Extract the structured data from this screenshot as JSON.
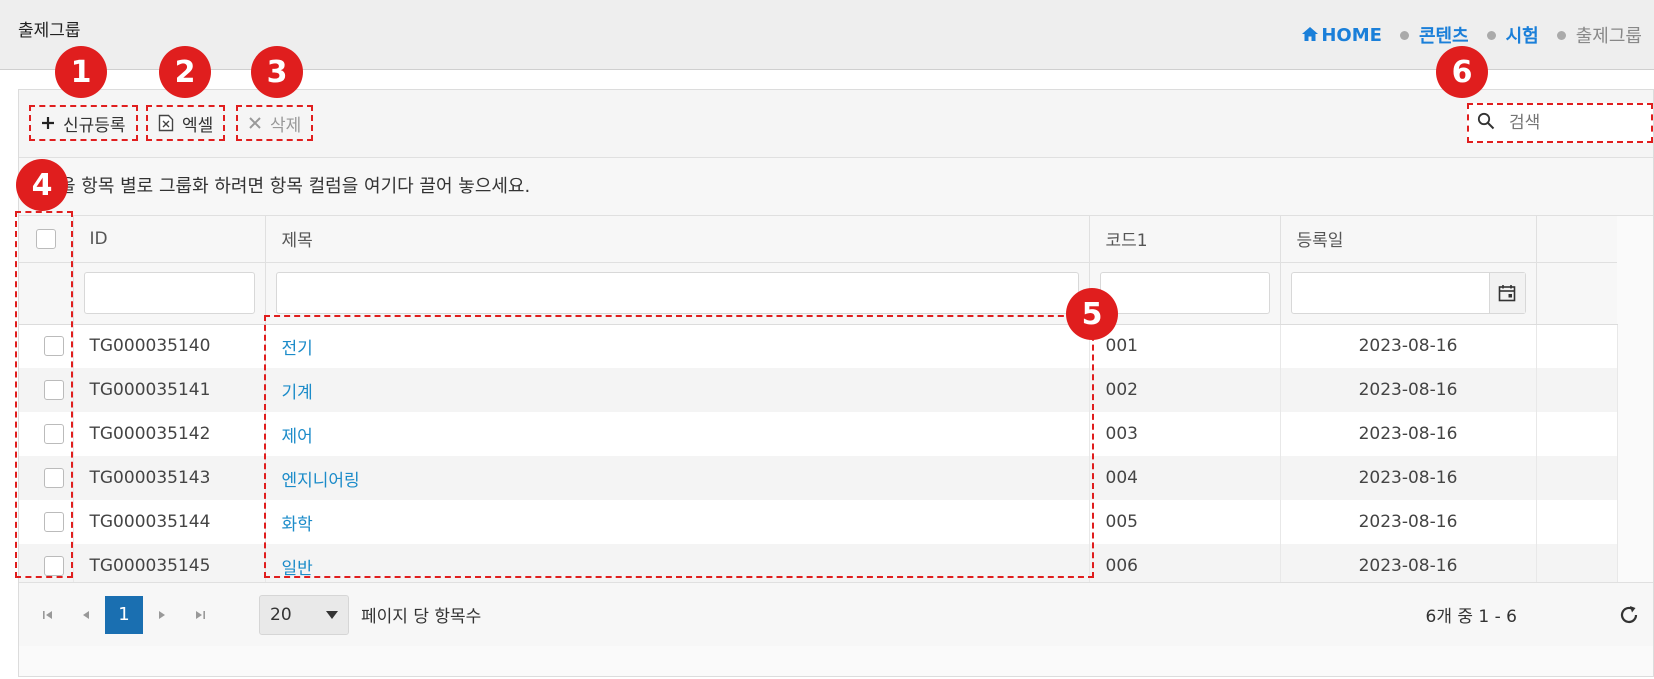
{
  "header": {
    "title": "출제그룹",
    "breadcrumb": [
      "HOME",
      "콘텐츠",
      "시험",
      "출제그룹"
    ]
  },
  "toolbar": {
    "new_label": "신규등록",
    "excel_label": "엑셀",
    "delete_label": "삭제",
    "search_placeholder": "검색"
  },
  "group_hint": "을 항목 별로 그룹화 하려면 항목 컬럼을 여기다 끌어 놓으세요.",
  "columns": [
    "ID",
    "제목",
    "코드1",
    "등록일"
  ],
  "rows": [
    {
      "id": "TG000035140",
      "title": "전기",
      "code": "001",
      "date": "2023-08-16"
    },
    {
      "id": "TG000035141",
      "title": "기계",
      "code": "002",
      "date": "2023-08-16"
    },
    {
      "id": "TG000035142",
      "title": "제어",
      "code": "003",
      "date": "2023-08-16"
    },
    {
      "id": "TG000035143",
      "title": "엔지니어링",
      "code": "004",
      "date": "2023-08-16"
    },
    {
      "id": "TG000035144",
      "title": "화학",
      "code": "005",
      "date": "2023-08-16"
    },
    {
      "id": "TG000035145",
      "title": "일반",
      "code": "006",
      "date": "2023-08-16"
    }
  ],
  "pager": {
    "current_page": "1",
    "page_size": "20",
    "per_page_label": "페이지 당 항목수",
    "info": "6개 중 1 - 6"
  },
  "annotations": [
    "1",
    "2",
    "3",
    "4",
    "5",
    "6"
  ],
  "colors": {
    "accent": "#1a6fb1",
    "link": "#1b8bc9",
    "annotation": "#e01e1e",
    "breadcrumb": "#1a7fd9"
  }
}
